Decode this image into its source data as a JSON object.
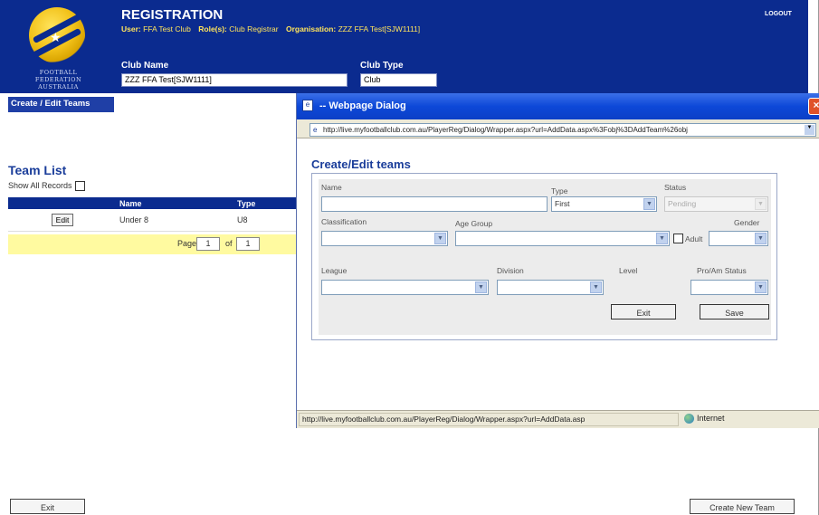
{
  "header": {
    "logo_lines": [
      "FOOTBALL",
      "FEDERATION",
      "AUSTRALIA"
    ],
    "title": "REGISTRATION",
    "user_label": "User:",
    "user_value": "FFA Test Club",
    "role_label": "Role(s):",
    "role_value": "Club Registrar",
    "org_label": "Organisation:",
    "org_value": "ZZZ FFA Test[SJW1111]",
    "logout": "LOGOUT",
    "club_name_label": "Club Name",
    "club_name_value": "ZZZ FFA Test[SJW1111]",
    "club_type_label": "Club Type",
    "club_type_value": "Club"
  },
  "nav": {
    "create_edit_tab": "Create / Edit Teams"
  },
  "team_list": {
    "title": "Team List",
    "show_all_label": "Show All Records",
    "columns": [
      "",
      "Name",
      "Type"
    ],
    "rows": [
      {
        "action": "Edit",
        "name": "Under 8",
        "type": "U8"
      }
    ],
    "pager": {
      "page_label": "Page",
      "page_value": "1",
      "of_label": "of",
      "of_value": "1"
    }
  },
  "footer": {
    "exit_label": "Exit",
    "create_new_label": "Create New Team"
  },
  "dialog": {
    "title": "-- Webpage Dialog",
    "close": "×",
    "url": "http://live.myfootballclub.com.au/PlayerReg/Dialog/Wrapper.aspx?url=AddData.aspx%3Fobj%3DAddTeam%26obj",
    "form_title": "Create/Edit teams",
    "fields": {
      "name_label": "Name",
      "name_value": "",
      "type_label": "Type",
      "type_value": "First",
      "status_label": "Status",
      "status_value": "Pending",
      "classification_label": "Classification",
      "age_group_label": "Age Group",
      "adult_label": "Adult",
      "gender_label": "Gender",
      "league_label": "League",
      "division_label": "Division",
      "level_label": "Level",
      "pro_am_label": "Pro/Am Status"
    },
    "buttons": {
      "exit": "Exit",
      "save": "Save"
    },
    "status_url": "http://live.myfootballclub.com.au/PlayerReg/Dialog/Wrapper.aspx?url=AddData.asp",
    "status_zone": "Internet"
  }
}
